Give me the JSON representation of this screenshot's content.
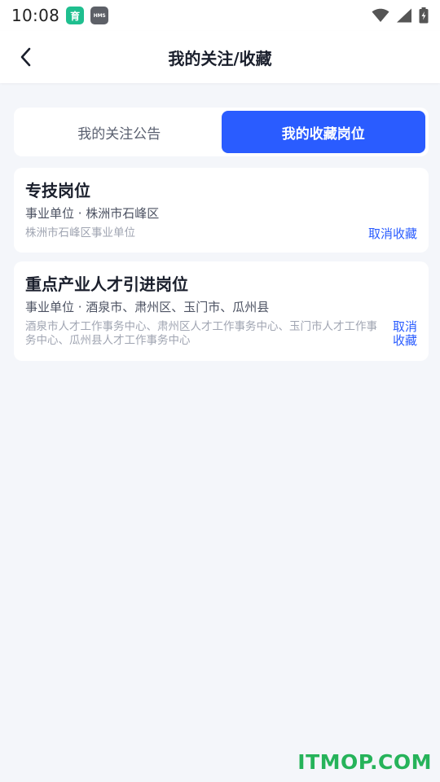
{
  "status_bar": {
    "time": "10:08",
    "notif_1": "育",
    "notif_2": "HMS",
    "icons": [
      "wifi-icon",
      "signal-icon",
      "battery-charging-icon"
    ]
  },
  "nav": {
    "title": "我的关注/收藏",
    "back_icon": "chevron-left-icon"
  },
  "tabs": [
    {
      "label": "我的关注公告",
      "active": false
    },
    {
      "label": "我的收藏岗位",
      "active": true
    }
  ],
  "favorites": [
    {
      "title": "专技岗位",
      "meta": "事业单位 · 株洲市石峰区",
      "org": "株洲市石峰区事业单位",
      "action": "取消收藏"
    },
    {
      "title": "重点产业人才引进岗位",
      "meta": "事业单位 · 酒泉市、肃州区、玉门市、瓜州县",
      "org": "酒泉市人才工作事务中心、肃州区人才工作事务中心、玉门市人才工作事务中心、瓜州县人才工作事务中心",
      "action": "取消收藏"
    }
  ],
  "watermark": "ITMOP.COM",
  "colors": {
    "accent": "#2a5cff",
    "background": "#f4f6fa",
    "watermark": "#26b35a"
  }
}
